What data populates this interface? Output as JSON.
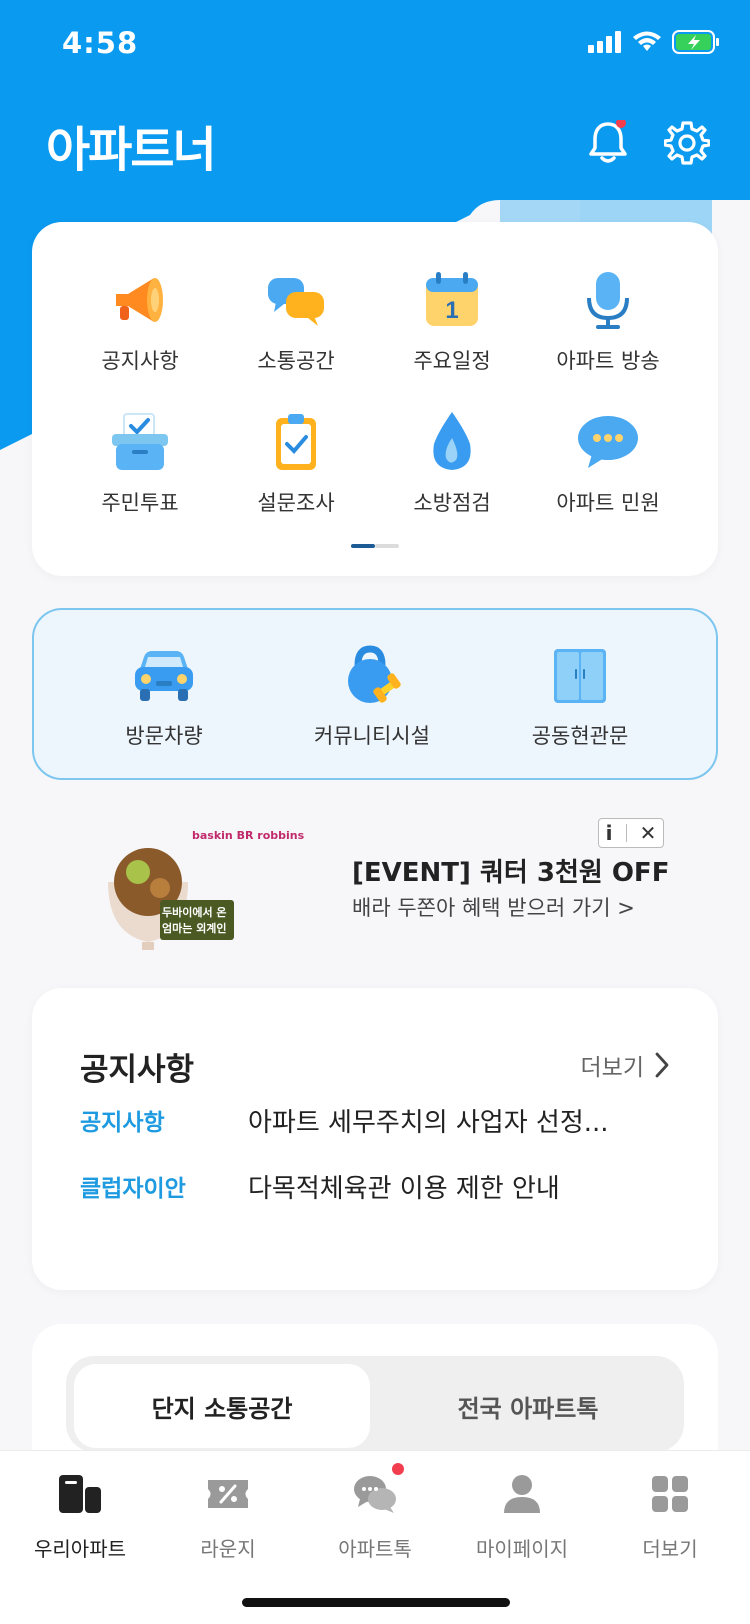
{
  "status_bar": {
    "time": "4:58"
  },
  "header": {
    "logo": "아파트너"
  },
  "menu": {
    "items": [
      {
        "label": "공지사항",
        "icon": "megaphone-icon"
      },
      {
        "label": "소통공간",
        "icon": "chat-bubbles-icon"
      },
      {
        "label": "주요일정",
        "icon": "calendar-icon"
      },
      {
        "label": "아파트 방송",
        "icon": "microphone-icon"
      },
      {
        "label": "주민투표",
        "icon": "ballot-box-icon"
      },
      {
        "label": "설문조사",
        "icon": "clipboard-icon"
      },
      {
        "label": "소방점검",
        "icon": "fire-drop-icon"
      },
      {
        "label": "아파트 민원",
        "icon": "speech-bubble-icon"
      }
    ],
    "calendar_day": "1"
  },
  "quick": {
    "items": [
      {
        "label": "방문차량",
        "icon": "car-icon"
      },
      {
        "label": "커뮤니티시설",
        "icon": "kettlebell-icon"
      },
      {
        "label": "공동현관문",
        "icon": "door-icon"
      }
    ]
  },
  "ad": {
    "brand": "baskin BR robbins",
    "badge_line1": "두바이에서 온",
    "badge_line2": "엄마는 외계인",
    "title": "[EVENT] 쿼터 3천원 OFF",
    "subtitle": "배라 두쫀아 혜택 받으러 가기 >",
    "info_label": "i",
    "close_label": "✕"
  },
  "notice": {
    "title": "공지사항",
    "more_label": "더보기",
    "rows": [
      {
        "category": "공지사항",
        "text": "아파트 세무주치의 사업자 선정..."
      },
      {
        "category": "클럽자이안",
        "text": "다목적체육관 이용 제한 안내"
      }
    ]
  },
  "community_tabs": {
    "active": "단지 소통공간",
    "inactive": "전국 아파트톡"
  },
  "bottom_nav": {
    "items": [
      {
        "label": "우리아파트",
        "icon": "building-icon"
      },
      {
        "label": "라운지",
        "icon": "coupon-icon"
      },
      {
        "label": "아파트톡",
        "icon": "chat-icon"
      },
      {
        "label": "마이페이지",
        "icon": "person-icon"
      },
      {
        "label": "더보기",
        "icon": "grid-icon"
      }
    ]
  },
  "colors": {
    "brand_blue": "#0A9AF0",
    "accent_blue": "#1E9BE0",
    "badge_red": "#F23D4F"
  }
}
